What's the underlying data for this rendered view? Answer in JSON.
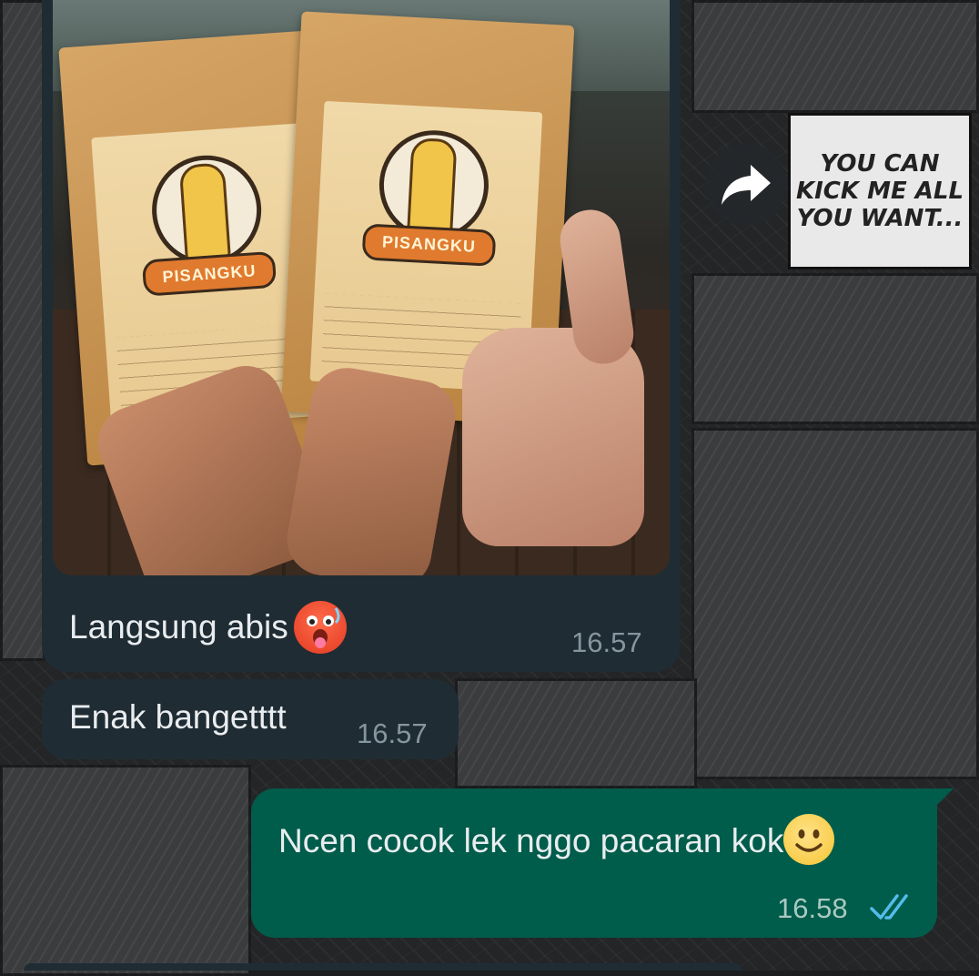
{
  "wallpaper": {
    "manga_caption": "YOU CAN\nKICK ME ALL\nYOU WANT..."
  },
  "forward_button": {
    "icon": "forward-arrow-icon"
  },
  "messages": [
    {
      "direction": "incoming",
      "type": "photo",
      "photo": {
        "pouch_left_brand": "PISANGKU",
        "pouch_right_brand": "PISANGKU"
      },
      "caption": "Langsung abis",
      "caption_emoji": "hot-face-emoji",
      "time": "16.57"
    },
    {
      "direction": "incoming",
      "type": "text",
      "text": "Enak bangetttt",
      "time": "16.57"
    },
    {
      "direction": "outgoing",
      "type": "text",
      "text": "Ncen cocok lek nggo pacaran kok",
      "text_emoji": "smiling-face-emoji",
      "time": "16.58",
      "status": "read",
      "status_icon": "double-check-icon",
      "status_color": "#53bdeb"
    }
  ],
  "colors": {
    "incoming_bubble": "#1f2c34",
    "outgoing_bubble": "#005c4b",
    "text": "#e9edef"
  }
}
